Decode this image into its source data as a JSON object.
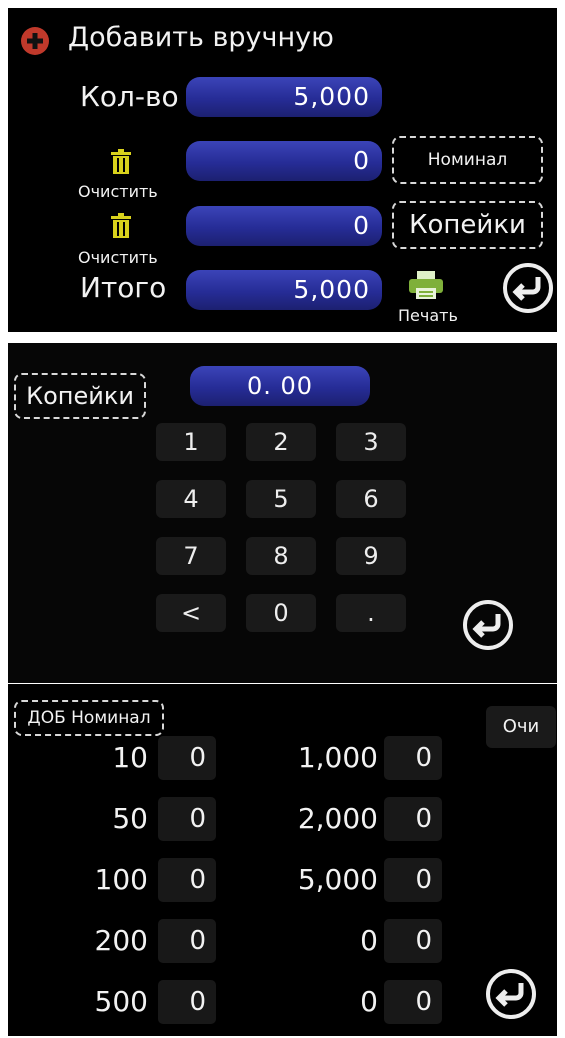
{
  "manual": {
    "title": "Добавить вручную",
    "qty_label": "Кол-во",
    "qty_value": "5,000",
    "row1_value": "0",
    "row2_value": "0",
    "clear_label": "Очистить",
    "denom_button": "Номинал",
    "kopeks_button": "Копейки",
    "total_label": "Итого",
    "total_value": "5,000",
    "print_label": "Печать"
  },
  "keypad": {
    "title": "Копейки",
    "display": "0. 00",
    "keys": [
      "1",
      "2",
      "3",
      "4",
      "5",
      "6",
      "7",
      "8",
      "9",
      "<",
      "0",
      "."
    ]
  },
  "denoms": {
    "title": "ДОБ Номинал",
    "clear_button": "Очи",
    "left": [
      {
        "label": "10",
        "value": "0"
      },
      {
        "label": "50",
        "value": "0"
      },
      {
        "label": "100",
        "value": "0"
      },
      {
        "label": "200",
        "value": "0"
      },
      {
        "label": "500",
        "value": "0"
      }
    ],
    "right": [
      {
        "label": "1,000",
        "value": "0"
      },
      {
        "label": "2,000",
        "value": "0"
      },
      {
        "label": "5,000",
        "value": "0"
      },
      {
        "label": "0",
        "value": "0"
      },
      {
        "label": "0",
        "value": "0"
      }
    ]
  },
  "colors": {
    "accent_blue": "#262c96",
    "add_icon_red": "#c0392b",
    "trash_yellow": "#d9d21c",
    "print_green": "#7fb03a"
  },
  "icons": [
    "plus-circle-icon",
    "trash-icon",
    "printer-icon",
    "return-icon"
  ]
}
